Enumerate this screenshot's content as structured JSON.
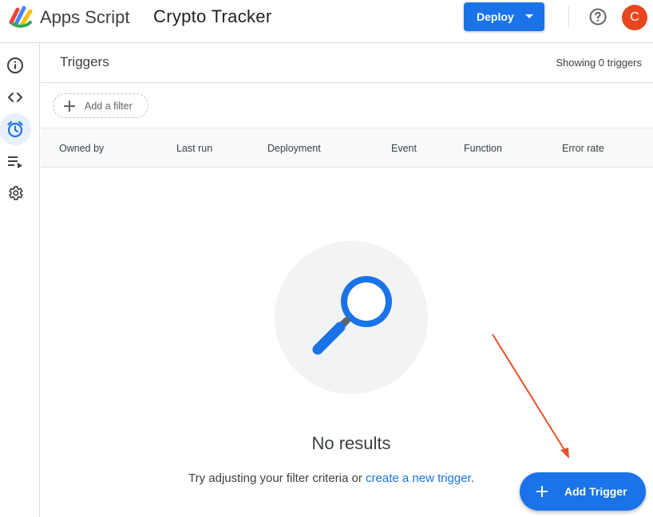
{
  "header": {
    "app_name": "Apps Script",
    "project_name": "Crypto Tracker",
    "deploy_label": "Deploy",
    "help_icon": "help-circle-icon",
    "avatar_initial": "C",
    "avatar_color": "#e8461e"
  },
  "rail": {
    "items": [
      {
        "icon": "info-icon",
        "active": false
      },
      {
        "icon": "code-icon",
        "active": false
      },
      {
        "icon": "alarm-clock-icon",
        "active": true
      },
      {
        "icon": "executions-icon",
        "active": false
      },
      {
        "icon": "gear-icon",
        "active": false
      }
    ]
  },
  "page": {
    "title": "Triggers",
    "showing": "Showing 0 triggers",
    "add_filter": "Add a filter"
  },
  "table": {
    "columns": [
      "Owned by",
      "Last run",
      "Deployment",
      "Event",
      "Function",
      "Error rate"
    ]
  },
  "empty_state": {
    "title": "No results",
    "hint_prefix": "Try adjusting your filter criteria or ",
    "hint_link": "create a new trigger",
    "hint_suffix": "."
  },
  "fab": {
    "label": "Add Trigger"
  },
  "colors": {
    "accent": "#1a73e8",
    "annotation_arrow": "#e8502c"
  }
}
